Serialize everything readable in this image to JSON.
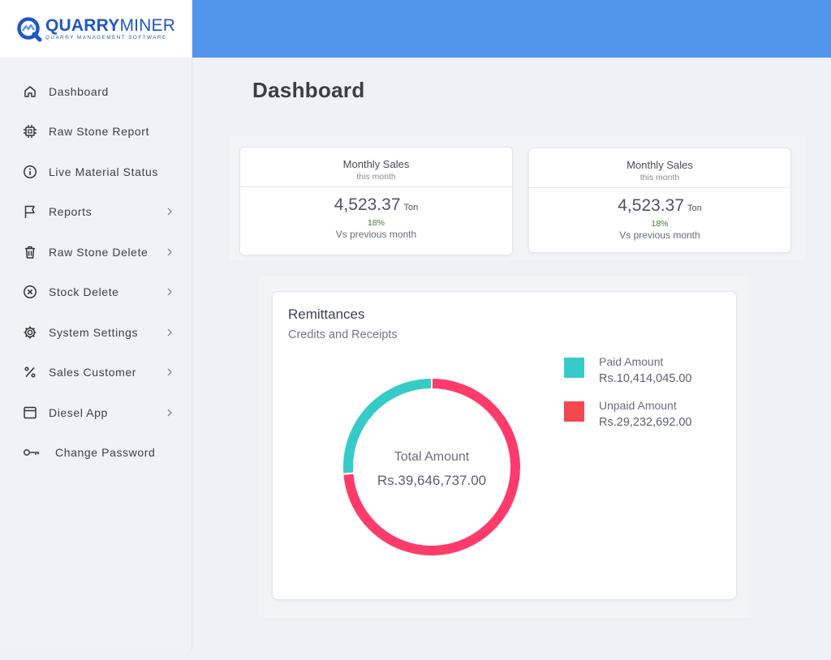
{
  "brand": {
    "name_bold": "QUARRY",
    "name_light": "MINER",
    "tagline": "QUARRY MANAGEMENT SOFTWARE",
    "color": "#1f57c3"
  },
  "sidebar": {
    "items": [
      {
        "label": "Dashboard",
        "icon": "home-icon",
        "chevron": false
      },
      {
        "label": "Raw Stone Report",
        "icon": "chip-icon",
        "chevron": false
      },
      {
        "label": "Live Material Status",
        "icon": "info-icon",
        "chevron": false
      },
      {
        "label": "Reports",
        "icon": "flag-icon",
        "chevron": true
      },
      {
        "label": "Raw Stone Delete",
        "icon": "trash-icon",
        "chevron": true
      },
      {
        "label": "Stock Delete",
        "icon": "x-circle-icon",
        "chevron": true
      },
      {
        "label": "System Settings",
        "icon": "gear-icon",
        "chevron": true
      },
      {
        "label": "Sales Customer",
        "icon": "percent-icon",
        "chevron": true
      },
      {
        "label": "Diesel App",
        "icon": "window-icon",
        "chevron": true
      },
      {
        "label": "Change Password",
        "icon": "key-icon",
        "chevron": false
      }
    ]
  },
  "header": {
    "bar_color": "#5294ea",
    "title": "Dashboard"
  },
  "stats": [
    {
      "title": "Monthly Sales",
      "subtitle": "this month",
      "value": "4,523.37",
      "unit": "Ton",
      "change": "18%",
      "comparison": "Vs previous month"
    },
    {
      "title": "Monthly Sales",
      "subtitle": "this month",
      "value": "4,523.37",
      "unit": "Ton",
      "change": "18%",
      "comparison": "Vs previous month"
    }
  ],
  "remittances": {
    "title": "Remittances",
    "subtitle": "Credits and Receipts",
    "center_label": "Total Amount",
    "center_value": "Rs.39,646,737.00",
    "legend": [
      {
        "name": "Paid Amount",
        "value": "Rs.10,414,045.00",
        "color": "#36cbc9"
      },
      {
        "name": "Unpaid Amount",
        "value": "Rs.29,232,692.00",
        "color": "#f5474f"
      }
    ]
  },
  "chart_data": {
    "type": "pie",
    "categories": [
      "Paid Amount",
      "Unpaid Amount"
    ],
    "values": [
      10414045.0,
      29232692.0
    ],
    "colors": [
      "#36cbc9",
      "#ff3b6b"
    ],
    "title": "Remittances",
    "subtitle": "Credits and Receipts",
    "donut": true,
    "total": 39646737.0,
    "legend": "right"
  }
}
